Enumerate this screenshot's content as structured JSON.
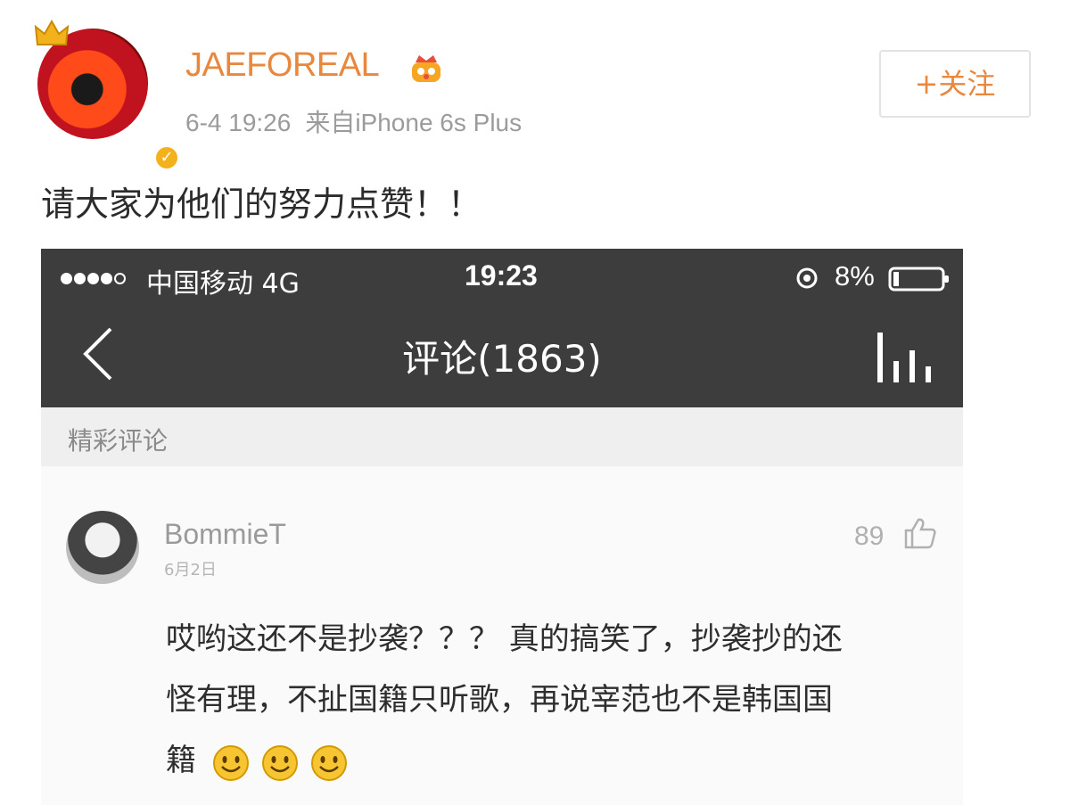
{
  "post": {
    "username": "JAEFOREAL",
    "time": "6-4 19:26",
    "source": "来自iPhone 6s Plus",
    "follow_label": "+关注",
    "text": "请大家为他们的努力点赞！！"
  },
  "embedded": {
    "status_bar": {
      "carrier": "中国移动  4G",
      "time": "19:23",
      "battery": "8%"
    },
    "nav": {
      "title": "评论(1863)"
    },
    "section_header": "精彩评论",
    "comment": {
      "user": "BommieT",
      "date": "6月2日",
      "likes": "89",
      "text": "哎哟这还不是抄袭？？？ 真的搞笑了，抄袭抄的还\n怪有理，不扯国籍只听歌，再说宰范也不是韩国国\n籍",
      "emoji_count": 3
    }
  },
  "colors": {
    "brand_orange": "#e7883e",
    "dark_bar": "#3d3d3d"
  },
  "icons": [
    "crown-icon",
    "vip-icon",
    "verified-icon",
    "signal-dots-icon",
    "lock-rotation-icon",
    "battery-icon",
    "back-icon",
    "stats-icon",
    "thumbs-up-icon",
    "smile-emoji-icon"
  ]
}
